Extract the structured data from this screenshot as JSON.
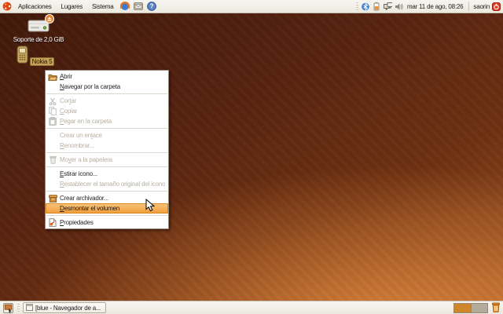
{
  "top_panel": {
    "menus": [
      {
        "label": "Aplicaciones"
      },
      {
        "label": "Lugares"
      },
      {
        "label": "Sistema"
      }
    ],
    "launcher_icons": [
      "firefox-icon",
      "mail-icon",
      "help-icon"
    ],
    "tray_icons": [
      "bluetooth-icon",
      "battery-icon",
      "network-icon",
      "volume-icon"
    ],
    "clock": "mar 11 de ago, 08:26",
    "username": "saorin",
    "logout_icon": "logout-icon"
  },
  "desktop": {
    "icons": [
      {
        "label": "Soporte de 2,0 GiB",
        "icon": "drive-icon",
        "emblem": "eject-emblem-icon",
        "selected": false
      },
      {
        "label": "Nokia 5",
        "icon": "phone-icon",
        "selected": true
      }
    ]
  },
  "context_menu": {
    "items": [
      {
        "type": "item",
        "label": "Abrir",
        "icon": "open-folder",
        "enabled": true,
        "mnemonic": 0
      },
      {
        "type": "item",
        "label": "Navegar por la carpeta",
        "enabled": true,
        "mnemonic": 0
      },
      {
        "type": "separator"
      },
      {
        "type": "item",
        "label": "Cortar",
        "icon": "cut",
        "enabled": false,
        "mnemonic": 3
      },
      {
        "type": "item",
        "label": "Copiar",
        "icon": "copy",
        "enabled": false,
        "mnemonic": 0
      },
      {
        "type": "item",
        "label": "Pegar en la carpeta",
        "icon": "paste",
        "enabled": false,
        "mnemonic": 0
      },
      {
        "type": "separator"
      },
      {
        "type": "item",
        "label": "Crear un enlace",
        "enabled": false,
        "mnemonic": 11
      },
      {
        "type": "item",
        "label": "Renombrar...",
        "enabled": false,
        "mnemonic": 0
      },
      {
        "type": "separator"
      },
      {
        "type": "item",
        "label": "Mover a la papelera",
        "icon": "trash",
        "enabled": false,
        "mnemonic": 2
      },
      {
        "type": "separator"
      },
      {
        "type": "item",
        "label": "Estirar icono...",
        "enabled": true,
        "mnemonic": 0
      },
      {
        "type": "item",
        "label": "Restablecer el tamaño original del icono",
        "enabled": false,
        "mnemonic": 0
      },
      {
        "type": "separator"
      },
      {
        "type": "item",
        "label": "Crear archivador...",
        "icon": "archive",
        "enabled": true
      },
      {
        "type": "item",
        "label": "Desmontar el volumen",
        "enabled": true,
        "highlighted": true,
        "mnemonic": 0
      },
      {
        "type": "separator"
      },
      {
        "type": "item",
        "label": "Propiedades",
        "icon": "properties",
        "enabled": true,
        "mnemonic": 0
      }
    ]
  },
  "bottom_panel": {
    "show_desktop_icon": "show-desktop-icon",
    "taskbar_items": [
      {
        "label": "[blue - Navegador de a...",
        "icon": "window-icon"
      }
    ],
    "workspaces": [
      {
        "active": true
      },
      {
        "active": false
      }
    ],
    "trash_icon": "trash-icon"
  },
  "colors": {
    "panel_bg": "#f2efe9",
    "menu_highlight": "#f09b38",
    "menu_highlight_border": "#d8871e",
    "selection_tan": "#c7a258",
    "desktop_dark": "#41190a",
    "desktop_bright": "#b2642f",
    "active_workspace": "#d0872c",
    "disabled_text": "#b9b1a3"
  }
}
